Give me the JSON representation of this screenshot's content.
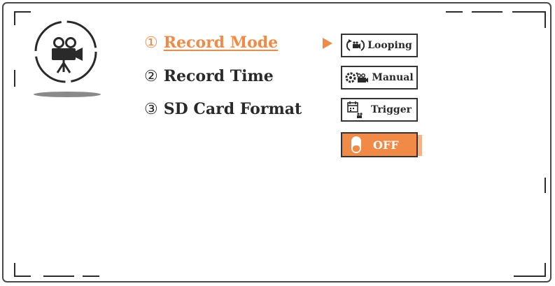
{
  "menu": {
    "items": [
      {
        "number": "①",
        "label": "Record Mode",
        "active": true
      },
      {
        "number": "②",
        "label": "Record Time",
        "active": false
      },
      {
        "number": "③",
        "label": "SD Card Format",
        "active": false
      }
    ]
  },
  "options": {
    "items": [
      {
        "label": "Looping",
        "icon": "loop-camera-icon"
      },
      {
        "label": "Manual",
        "icon": "manual-camera-icon"
      },
      {
        "label": "Trigger",
        "icon": "calendar-trigger-icon"
      },
      {
        "label": "OFF",
        "icon": "toggle-off-icon",
        "selected": true
      }
    ]
  },
  "colors": {
    "accent": "#f18a47",
    "text": "#2a2a2a",
    "border": "#333333"
  }
}
